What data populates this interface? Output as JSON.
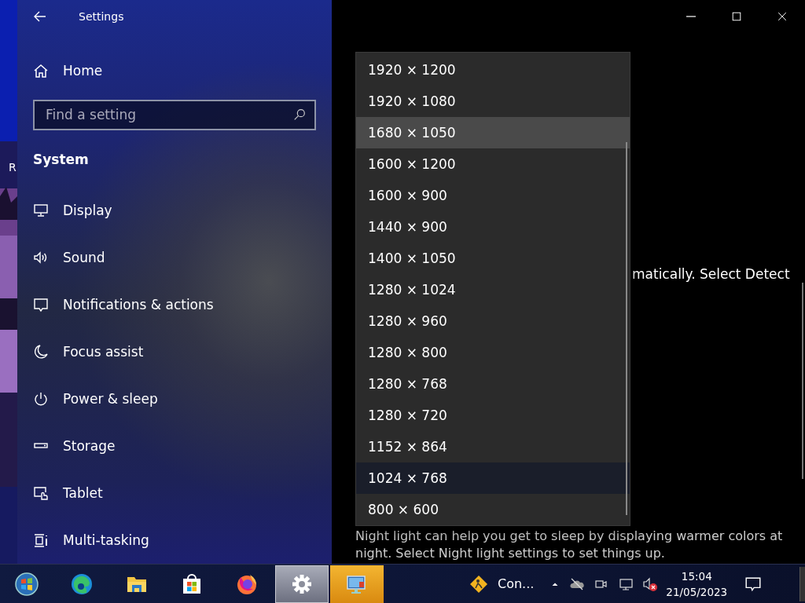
{
  "desktop": {
    "icon_label": "R"
  },
  "window": {
    "title": "Settings"
  },
  "sidebar": {
    "home": "Home",
    "search": {
      "placeholder": "Find a setting"
    },
    "section": "System",
    "items": [
      {
        "label": "Display"
      },
      {
        "label": "Sound"
      },
      {
        "label": "Notifications & actions"
      },
      {
        "label": "Focus assist"
      },
      {
        "label": "Power & sleep"
      },
      {
        "label": "Storage"
      },
      {
        "label": "Tablet"
      },
      {
        "label": "Multi-tasking"
      }
    ]
  },
  "content": {
    "text_1": "matically. Select Detect",
    "night_light_text": "Night light can help you get to sleep by displaying warmer colors at night. Select Night light settings to set things up."
  },
  "dropdown": {
    "options": [
      {
        "label": "1920 × 1200",
        "selected": false,
        "hovered": false
      },
      {
        "label": "1920 × 1080",
        "selected": false,
        "hovered": false
      },
      {
        "label": "1680 × 1050",
        "selected": false,
        "hovered": true
      },
      {
        "label": "1600 × 1200",
        "selected": false,
        "hovered": false
      },
      {
        "label": "1600 × 900",
        "selected": false,
        "hovered": false
      },
      {
        "label": "1440 × 900",
        "selected": false,
        "hovered": false
      },
      {
        "label": "1400 × 1050",
        "selected": false,
        "hovered": false
      },
      {
        "label": "1280 × 1024",
        "selected": false,
        "hovered": false
      },
      {
        "label": "1280 × 960",
        "selected": false,
        "hovered": false
      },
      {
        "label": "1280 × 800",
        "selected": false,
        "hovered": false
      },
      {
        "label": "1280 × 768",
        "selected": false,
        "hovered": false
      },
      {
        "label": "1280 × 720",
        "selected": false,
        "hovered": false
      },
      {
        "label": "1152 × 864",
        "selected": false,
        "hovered": false
      },
      {
        "label": "1024 × 768",
        "selected": true,
        "hovered": false
      },
      {
        "label": "800 × 600",
        "selected": false,
        "hovered": false
      }
    ]
  },
  "taskbar": {
    "apps": [
      {
        "active": false,
        "flashing": false
      },
      {
        "active": false,
        "flashing": false
      },
      {
        "active": false,
        "flashing": false
      },
      {
        "active": false,
        "flashing": false
      },
      {
        "active": false,
        "flashing": false
      },
      {
        "active": true,
        "flashing": false
      },
      {
        "active": false,
        "flashing": true
      }
    ],
    "task": {
      "label": "Con..."
    },
    "time": "15:04",
    "date": "21/05/2023"
  }
}
